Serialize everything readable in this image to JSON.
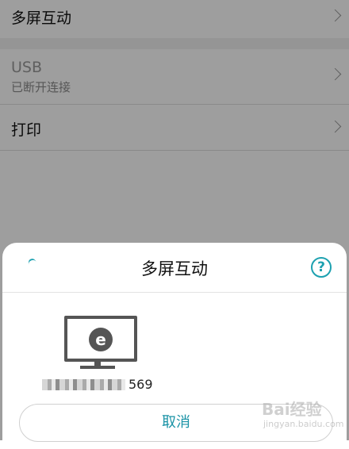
{
  "settings": {
    "multiscreen": {
      "title": "多屏互动"
    },
    "usb": {
      "title": "USB",
      "subtitle": "已断开连接"
    },
    "print": {
      "title": "打印"
    }
  },
  "dialog": {
    "title": "多屏互动",
    "help_glyph": "?",
    "devices": [
      {
        "name_suffix": "569",
        "icon": "tv-icon"
      }
    ],
    "cancel_label": "取消"
  },
  "watermark": {
    "text": "Bai经验",
    "url": "jingyan.baidu.com"
  },
  "colors": {
    "accent": "#1da1b0",
    "cancel_text": "#1a93a6",
    "overlay": "rgba(0,0,0,0.38)"
  }
}
